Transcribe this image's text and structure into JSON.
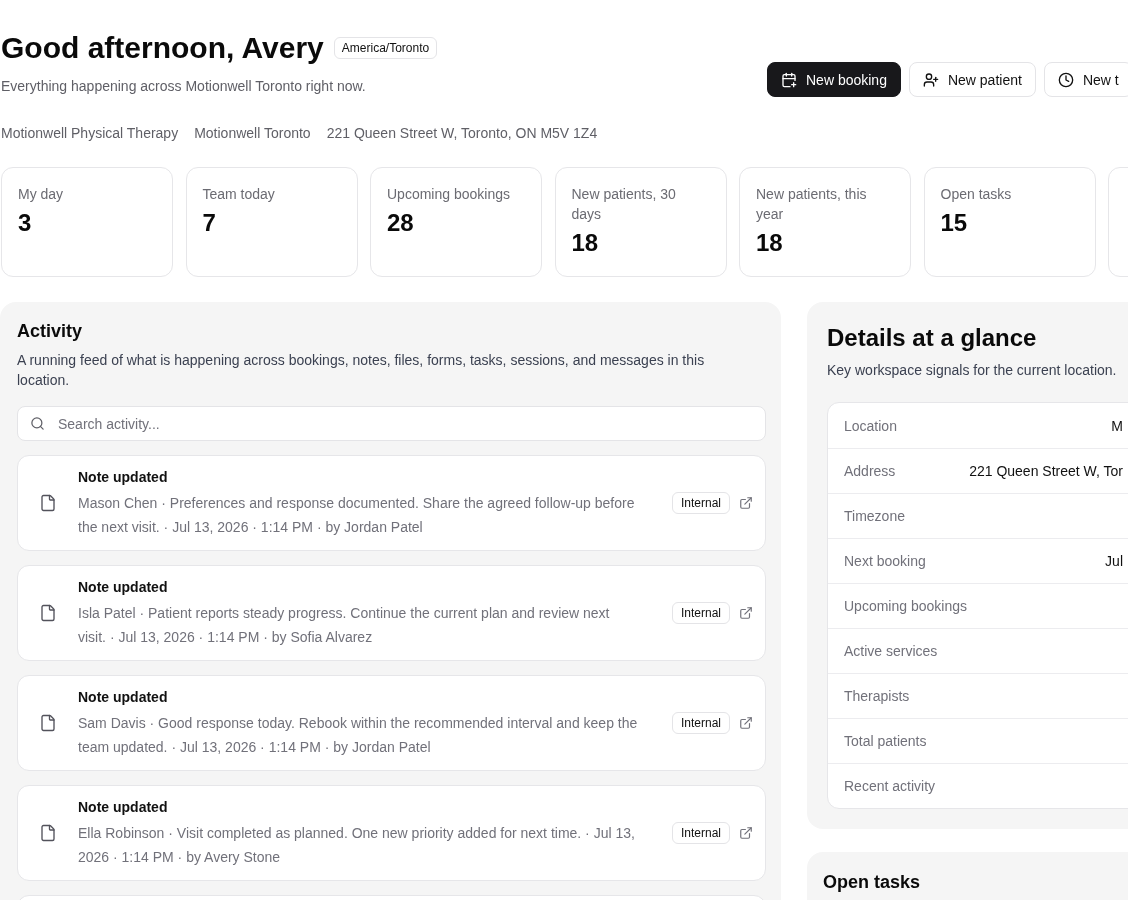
{
  "header": {
    "greeting": "Good afternoon, Avery",
    "timezone_badge": "America/Toronto",
    "subtitle": "Everything happening across Motionwell Toronto right now.",
    "meta": [
      "Motionwell Physical Therapy",
      "Motionwell Toronto",
      "221 Queen Street W, Toronto, ON M5V 1Z4"
    ]
  },
  "actions": [
    {
      "label": "New booking",
      "kind": "primary"
    },
    {
      "label": "New patient",
      "kind": "secondary"
    },
    {
      "label": "New t",
      "kind": "secondary"
    }
  ],
  "stats": [
    {
      "label": "My day",
      "value": "3"
    },
    {
      "label": "Team today",
      "value": "7"
    },
    {
      "label": "Upcoming bookings",
      "value": "28"
    },
    {
      "label": "New patients, 30 days",
      "value": "18"
    },
    {
      "label": "New patients, this year",
      "value": "18"
    },
    {
      "label": "Open tasks",
      "value": "15"
    }
  ],
  "stats_overflow": true,
  "activity": {
    "title": "Activity",
    "description": "A running feed of what is happening across bookings, notes, files, forms, tasks, sessions, and messages in this location.",
    "search": {
      "placeholder": "Search activity..."
    },
    "items": [
      {
        "title": "Note updated",
        "text": "Mason Chen · Preferences and response documented. Share the agreed follow-up before the next visit. · Jul 13, 2026 · 1:14 PM · by Jordan Patel",
        "badge": "Internal"
      },
      {
        "title": "Note updated",
        "text": "Isla Patel · Patient reports steady progress. Continue the current plan and review next visit. · Jul 13, 2026 · 1:14 PM · by Sofia Alvarez",
        "badge": "Internal"
      },
      {
        "title": "Note updated",
        "text": "Sam Davis · Good response today. Rebook within the recommended interval and keep the team updated. · Jul 13, 2026 · 1:14 PM · by Jordan Patel",
        "badge": "Internal"
      },
      {
        "title": "Note updated",
        "text": "Ella Robinson · Visit completed as planned. One new priority added for next time. · Jul 13, 2026 · 1:14 PM · by Avery Stone",
        "badge": "Internal"
      }
    ],
    "more_below": true
  },
  "details": {
    "title": "Details at a glance",
    "subtitle": "Key workspace signals for the current location.",
    "rows": [
      {
        "label": "Location",
        "value": "M"
      },
      {
        "label": "Address",
        "value": "221 Queen Street W, Tor"
      },
      {
        "label": "Timezone"
      },
      {
        "label": "Next booking",
        "value": "Jul"
      },
      {
        "label": "Upcoming bookings"
      },
      {
        "label": "Active services"
      },
      {
        "label": "Therapists"
      },
      {
        "label": "Total patients"
      },
      {
        "label": "Recent activity"
      }
    ]
  },
  "open_tasks": {
    "title": "Open tasks"
  }
}
